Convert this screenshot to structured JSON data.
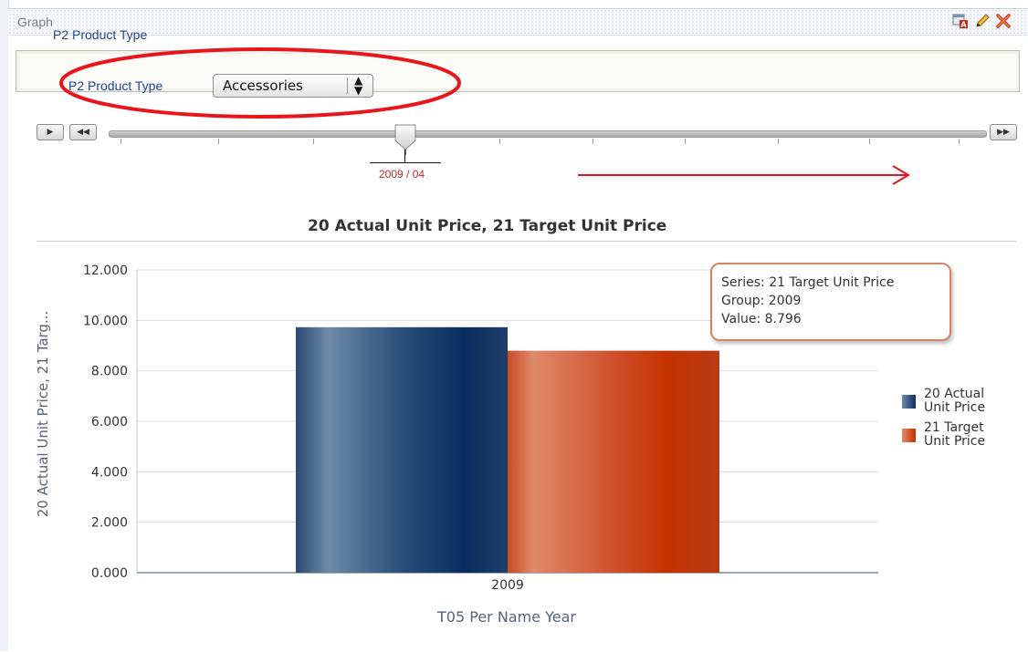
{
  "panel": {
    "title": "Graph",
    "icons": [
      "edit-format-icon",
      "pencil-icon",
      "delete-icon"
    ]
  },
  "prompt": {
    "label": "P2 Product Type",
    "select": {
      "value": "Accessories"
    }
  },
  "slider": {
    "value_label": "2009 / 04",
    "buttons": [
      "play-icon",
      "step-back-icon",
      "step-forward-icon"
    ]
  },
  "chart_data": {
    "type": "bar",
    "title": "20 Actual Unit Price, 21 Target Unit Price",
    "xlabel": "T05 Per Name Year",
    "ylabel": "20  Actual Unit Price, 21  Targ...",
    "categories": [
      "2009"
    ],
    "series": [
      {
        "name": "20 Actual Unit Price",
        "values": [
          9.73
        ],
        "color": "#1c3f6b"
      },
      {
        "name": "21 Target Unit Price",
        "values": [
          8.796
        ],
        "color": "#c8401c"
      }
    ],
    "ylim": [
      0,
      12
    ],
    "yticks": [
      "0.000",
      "2.000",
      "4.000",
      "6.000",
      "8.000",
      "10.000",
      "12.000"
    ],
    "grid": true,
    "legend": "right"
  },
  "legend": {
    "items": [
      {
        "line1": "20 Actual",
        "line2": "Unit Price"
      },
      {
        "line1": "21 Target",
        "line2": "Unit Price"
      }
    ]
  },
  "tooltip": {
    "series": "Series: 21 Target Unit Price",
    "group": "Group: 2009",
    "value": "Value: 8.796"
  },
  "colors": {
    "prompt_label": "#22469a",
    "slider_value": "#c0262c",
    "annotation": "#e8161c"
  }
}
